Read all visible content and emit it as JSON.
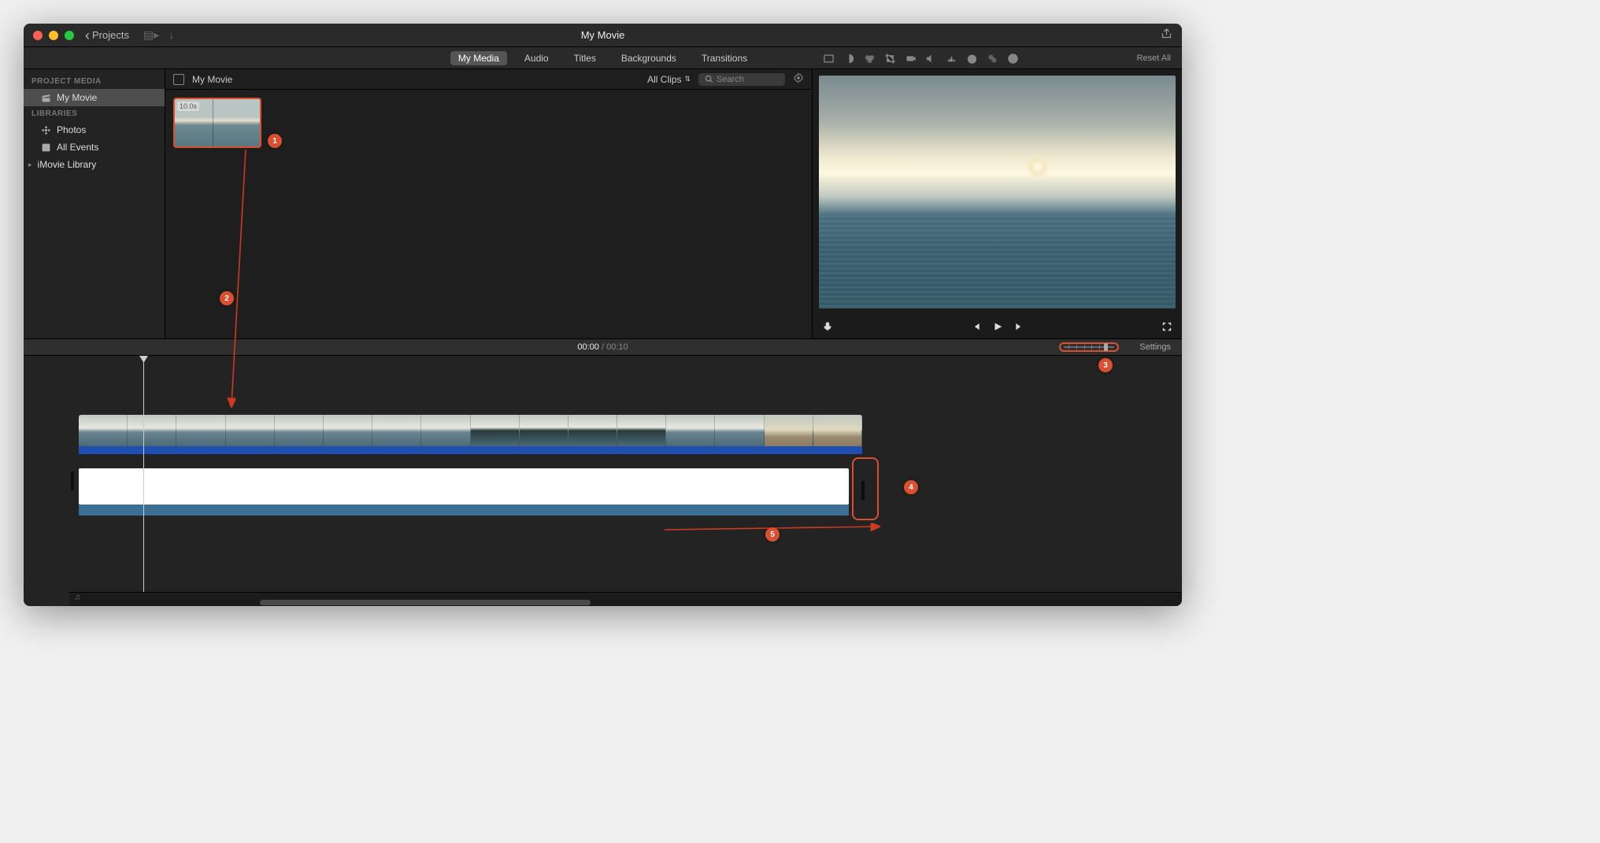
{
  "titlebar": {
    "projects_label": "Projects",
    "title": "My Movie"
  },
  "tabs": {
    "my_media": "My Media",
    "audio": "Audio",
    "titles": "Titles",
    "backgrounds": "Backgrounds",
    "transitions": "Transitions"
  },
  "inspector": {
    "reset_all": "Reset All"
  },
  "sidebar": {
    "group_project": "PROJECT MEDIA",
    "project_item": "My Movie",
    "group_libraries": "LIBRARIES",
    "photos": "Photos",
    "all_events": "All Events",
    "imovie_library": "iMovie Library"
  },
  "browser": {
    "title": "My Movie",
    "filter": "All Clips",
    "search_placeholder": "Search",
    "clip_duration": "10.0s"
  },
  "timeline_header": {
    "current": "00:00",
    "total": "00:10",
    "settings": "Settings"
  },
  "annotations": {
    "b1": "1",
    "b2": "2",
    "b3": "3",
    "b4": "4",
    "b5": "5"
  },
  "colors": {
    "annotation": "#d94f2f",
    "video_bar": "#1e4fb0",
    "title_bar": "#3b6f93"
  }
}
